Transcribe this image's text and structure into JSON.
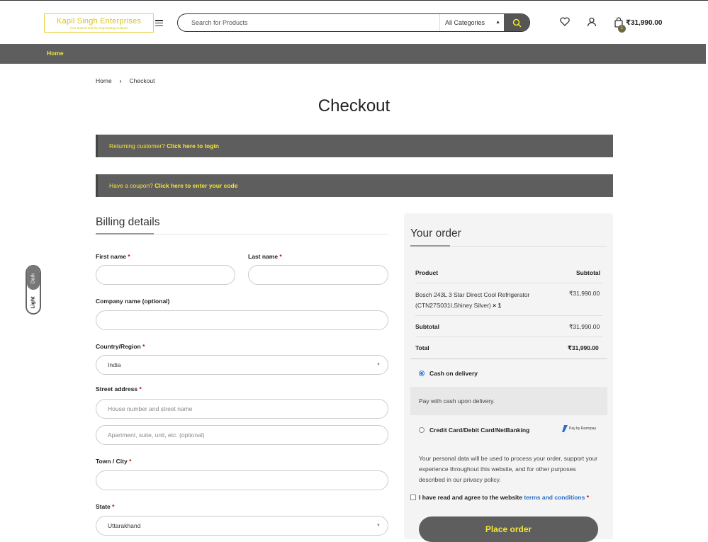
{
  "header": {
    "logo_name": "Kapil Singh Enterprises",
    "logo_tagline": "Your trusted hub for long-lasting products",
    "search_placeholder": "Search for Products",
    "category_selected": "All Categories",
    "cart_total": "₹31,990.00",
    "cart_count": "1"
  },
  "nav": {
    "home": "Home"
  },
  "breadcrumb": {
    "home": "Home",
    "sep": "›",
    "current": "Checkout"
  },
  "page_title": "Checkout",
  "notices": {
    "login_prefix": "Returning customer?",
    "login_link": "Click here to login",
    "coupon_prefix": "Have a coupon?",
    "coupon_link": "Click here to enter your code"
  },
  "theme_toggle": {
    "dark": "Dark",
    "light": "Light"
  },
  "billing": {
    "heading": "Billing details",
    "first_name": "First name",
    "last_name": "Last name",
    "company": "Company name (optional)",
    "country": "Country/Region",
    "country_value": "India",
    "street": "Street address",
    "street_ph1": "House number and street name",
    "street_ph2": "Apartment, suite, unit, etc. (optional)",
    "city": "Town / City",
    "state": "State",
    "state_value": "Uttarakhand",
    "req": "*"
  },
  "order": {
    "heading": "Your order",
    "col_product": "Product",
    "col_subtotal": "Subtotal",
    "item_name": "Bosch 243L 3 Star Direct Cool Refrigerator (CTN27S031I,Shiney Silver)",
    "item_qty": "× 1",
    "item_price": "₹31,990.00",
    "subtotal_label": "Subtotal",
    "subtotal_value": "₹31,990.00",
    "total_label": "Total",
    "total_value": "₹31,990.00",
    "pay_cod": "Cash on delivery",
    "pay_cod_desc": "Pay with cash upon delivery.",
    "pay_card": "Credit Card/Debit Card/NetBanking",
    "razorpay": "Pay by Razorpay",
    "privacy": "Your personal data will be used to process your order, support your experience throughout this website, and for other purposes described in our privacy policy.",
    "terms_prefix": "I have read and agree to the website",
    "terms_link": "terms and conditions",
    "place_order": "Place order"
  },
  "colors": {
    "accent": "#f5e534",
    "bar": "#5e5e5e",
    "link": "#2a6fc9"
  }
}
